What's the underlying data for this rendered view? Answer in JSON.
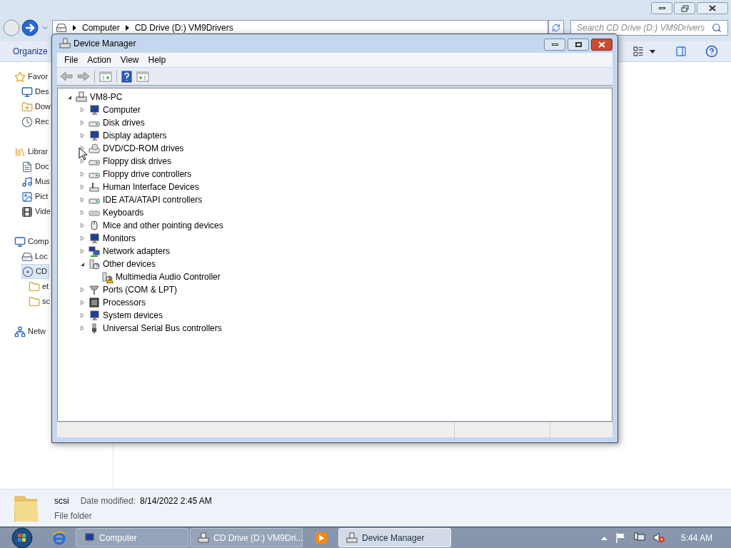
{
  "explorer": {
    "address_bar": {
      "breadcrumbs": [
        "Computer",
        "CD Drive (D:) VM9Drivers"
      ]
    },
    "search": {
      "placeholder": "Search CD Drive (D:) VM9Drivers"
    },
    "toolbar": {
      "organize": "Organize"
    },
    "nav_pane": {
      "groups": [
        {
          "label": "Favor",
          "selected": false,
          "children": [
            {
              "label": "Des",
              "selected": false
            },
            {
              "label": "Dow",
              "selected": false
            },
            {
              "label": "Rec",
              "selected": false
            }
          ]
        },
        {
          "label": "Librar",
          "selected": false,
          "children": [
            {
              "label": "Doc",
              "selected": false
            },
            {
              "label": "Mus",
              "selected": false
            },
            {
              "label": "Pict",
              "selected": false
            },
            {
              "label": "Vide",
              "selected": false
            }
          ]
        },
        {
          "label": "Comp",
          "selected": false,
          "children": [
            {
              "label": "Loc",
              "selected": false
            },
            {
              "label": "CD",
              "selected": true,
              "children": [
                {
                  "label": "et",
                  "selected": false
                },
                {
                  "label": "sc",
                  "selected": false
                }
              ]
            }
          ]
        },
        {
          "label": "Netw",
          "selected": false
        }
      ]
    },
    "details": {
      "name": "scsi",
      "type": "File folder",
      "date_label": "Date modified:",
      "date": "8/14/2022 2:45 AM"
    }
  },
  "device_manager": {
    "title": "Device Manager",
    "menu": [
      "File",
      "Action",
      "View",
      "Help"
    ],
    "tree": {
      "label": "VM8-PC",
      "expanded": true,
      "children": [
        {
          "label": "Computer",
          "expanded": false
        },
        {
          "label": "Disk drives",
          "expanded": false
        },
        {
          "label": "Display adapters",
          "expanded": false
        },
        {
          "label": "DVD/CD-ROM drives",
          "expanded": false
        },
        {
          "label": "Floppy disk drives",
          "expanded": false
        },
        {
          "label": "Floppy drive controllers",
          "expanded": false
        },
        {
          "label": "Human Interface Devices",
          "expanded": false
        },
        {
          "label": "IDE ATA/ATAPI controllers",
          "expanded": false
        },
        {
          "label": "Keyboards",
          "expanded": false
        },
        {
          "label": "Mice and other pointing devices",
          "expanded": false
        },
        {
          "label": "Monitors",
          "expanded": false
        },
        {
          "label": "Network adapters",
          "expanded": false
        },
        {
          "label": "Other devices",
          "expanded": true,
          "children": [
            {
              "label": "Multimedia Audio Controller",
              "warning": true
            }
          ]
        },
        {
          "label": "Ports (COM & LPT)",
          "expanded": false
        },
        {
          "label": "Processors",
          "expanded": false
        },
        {
          "label": "System devices",
          "expanded": false
        },
        {
          "label": "Universal Serial Bus controllers",
          "expanded": false
        }
      ]
    }
  },
  "taskbar": {
    "tasks": [
      {
        "kind": "pinned"
      },
      {
        "kind": "window",
        "label": "Computer",
        "selected": false
      },
      {
        "kind": "window",
        "label": "CD Drive (D:) VM9Dri...",
        "selected": false
      },
      {
        "kind": "pinned"
      },
      {
        "kind": "window",
        "label": "Device Manager",
        "selected": true
      }
    ],
    "clock": "5:44 AM"
  }
}
